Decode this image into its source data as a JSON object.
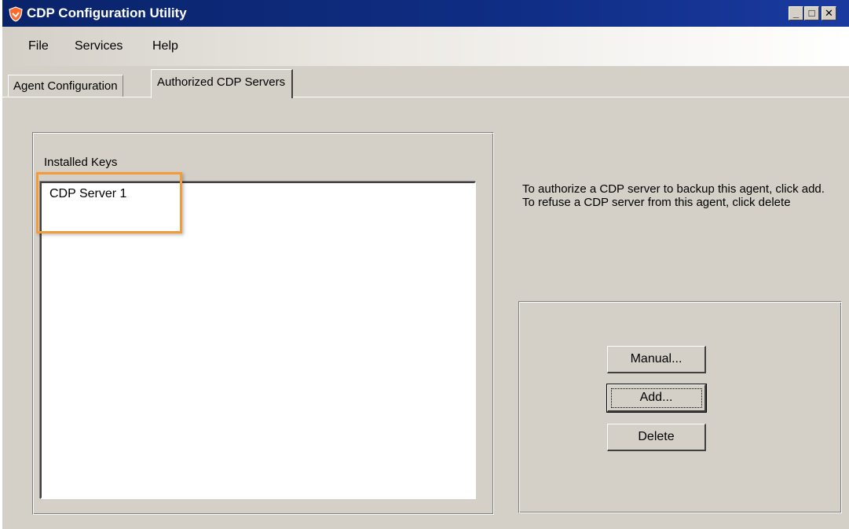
{
  "window": {
    "title": "CDP Configuration Utility"
  },
  "menu": {
    "items": [
      "File",
      "Services",
      "Help"
    ]
  },
  "tabs": [
    {
      "label": "Agent Configuration",
      "active": false
    },
    {
      "label": "Authorized CDP Servers",
      "active": true
    }
  ],
  "installed_keys": {
    "label": "Installed Keys",
    "items": [
      "CDP Server 1"
    ]
  },
  "info_text": "To authorize a CDP server to backup this agent, click add. To refuse a CDP server from this agent, click delete",
  "buttons": {
    "manual": "Manual...",
    "add": "Add...",
    "delete": "Delete"
  },
  "window_controls": {
    "minimize": "_",
    "maximize": "□",
    "close": "✕"
  },
  "colors": {
    "titlebar": "#0a246a",
    "highlight": "#f29b38",
    "face": "#d4d0c8"
  }
}
